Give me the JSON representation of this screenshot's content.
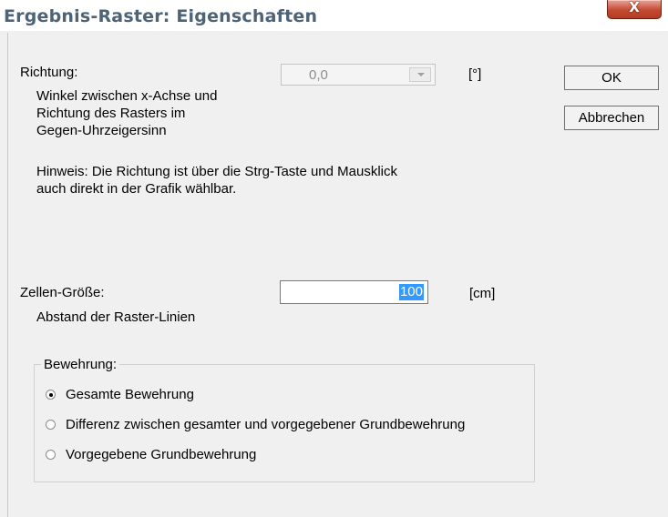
{
  "window": {
    "title": "Ergebnis-Raster: Eigenschaften",
    "close_glyph": "X"
  },
  "richtung": {
    "label": "Richtung:",
    "description_lines": [
      "Winkel zwischen x-Achse und",
      "Richtung des Rasters im",
      "Gegen-Uhrzeigersinn"
    ],
    "value": "0,0",
    "unit": "[°]",
    "enabled": false
  },
  "hint": {
    "lines": [
      "Hinweis: Die Richtung ist über die Strg-Taste und Mausklick",
      "auch direkt in der Grafik wählbar."
    ]
  },
  "zellen": {
    "label": "Zellen-Größe:",
    "description": "Abstand der Raster-Linien",
    "value": "100",
    "unit": "[cm]"
  },
  "bewehrung": {
    "label": "Bewehrung:",
    "options": [
      {
        "label": "Gesamte Bewehrung",
        "selected": true
      },
      {
        "label": "Differenz zwischen gesamter und vorgegebener Grundbewehrung",
        "selected": false
      },
      {
        "label": "Vorgegebene Grundbewehrung",
        "selected": false
      }
    ]
  },
  "buttons": {
    "ok": "OK",
    "cancel": "Abbrechen"
  },
  "icons": {
    "close": "close-icon",
    "dropdown": "chevron-down-icon"
  }
}
